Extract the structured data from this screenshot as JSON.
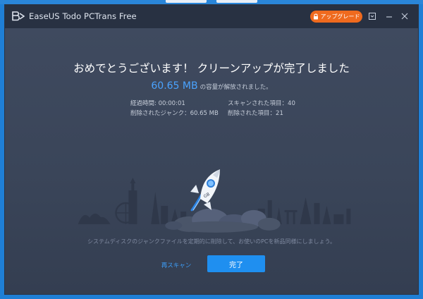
{
  "window": {
    "title": "EaseUS Todo PCTrans Free",
    "upgrade_label": "アップグレード"
  },
  "result": {
    "headline": "おめでとうございます！ クリーンアップが完了しました",
    "freed_size": "60.65 MB",
    "freed_suffix": "の容量が解放されました。"
  },
  "stats": {
    "elapsed_label": "経過時間",
    "elapsed_value": "00:00:01",
    "deleted_junk_label": "削除されたジャンク",
    "deleted_junk_value": "60.65 MB",
    "scanned_items_label": "スキャンされた項目",
    "scanned_items_value": "40",
    "deleted_items_label": "削除された項目",
    "deleted_items_value": "21"
  },
  "illustration": {
    "rocket_badge": "GB"
  },
  "tip": "システムディスクのジャンクファイルを定期的に削除して、お使いのPCを新品同様にしましょう。",
  "actions": {
    "rescan_label": "再スキャン",
    "done_label": "完了"
  },
  "colors": {
    "accent": "#1f8ff0",
    "size_highlight": "#4aa3ff",
    "upgrade": "#ef6a1e",
    "titlebar": "#283142",
    "background": "#3b4559"
  },
  "icons": {
    "lock": "lock-icon",
    "feedback": "feedback-icon",
    "minimize": "minimize-icon",
    "close": "close-icon"
  }
}
